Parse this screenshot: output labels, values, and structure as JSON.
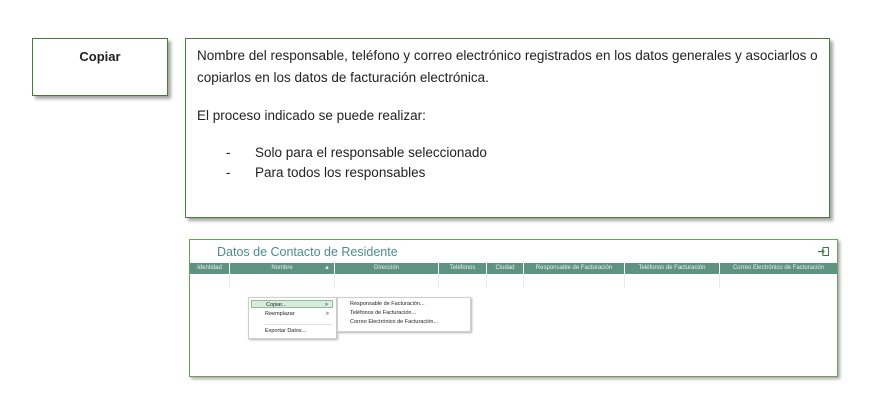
{
  "label": {
    "text": "Copiar"
  },
  "description": {
    "paragraph1": "Nombre del responsable, teléfono y correo electrónico registrados en los datos generales y asociarlos o copiarlos en los datos de facturación electrónica.",
    "paragraph2": "El proceso indicado se puede realizar:",
    "list": [
      "Solo para el responsable seleccionado",
      "Para todos los responsables"
    ]
  },
  "app": {
    "title": "Datos de Contacto de Residente",
    "columns": [
      "Identidad",
      "Nombre",
      "Dirección",
      "Teléfonos",
      "Ciudad",
      "Responsable de Facturación",
      "Teléfonos de Facturación",
      "Correo Electrónico de Facturación"
    ],
    "sort_indicator": "▲",
    "context_menu": {
      "items": [
        "Copiar...",
        "Reemplazar",
        "Exportar Datos..."
      ],
      "submenu_arrow": ">"
    },
    "submenu": {
      "items": [
        "Responsable de Facturación...",
        "Teléfonos de Facturación...",
        "Correo Electrónico de Facturación..."
      ]
    }
  },
  "colors": {
    "border_green": "#4a7a3a",
    "header_bg": "#5e9381",
    "title_color": "#4f8a8c",
    "menu_highlight": "#d9ecdd"
  }
}
